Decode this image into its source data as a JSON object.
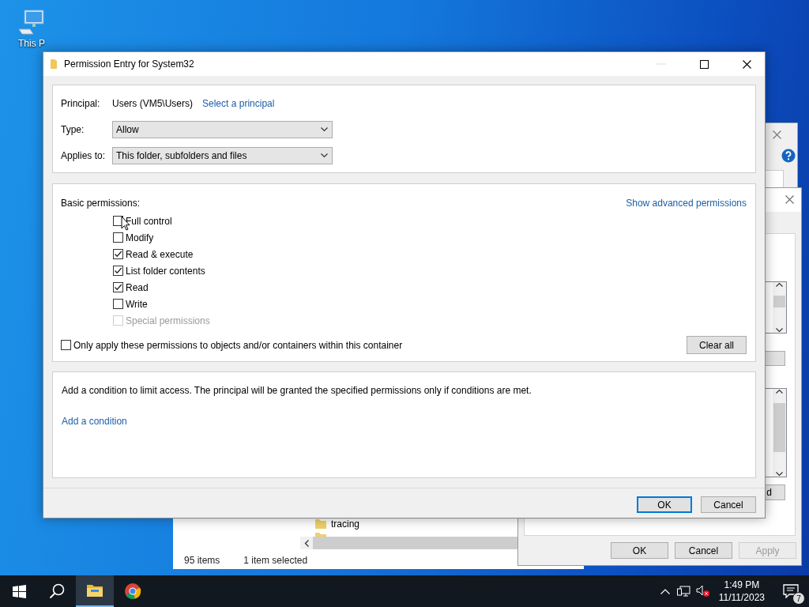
{
  "desktop": {
    "icons": [
      {
        "label": "This P"
      }
    ]
  },
  "explorer_window": {
    "items": [
      {
        "name": "tracing"
      }
    ],
    "status_bar": [
      "95 items",
      "1 item selected"
    ]
  },
  "security_dialog": {
    "partial_button": "d",
    "buttons": [
      {
        "label": "OK",
        "disabled": false
      },
      {
        "label": "Cancel",
        "disabled": false
      },
      {
        "label": "Apply",
        "disabled": true
      }
    ]
  },
  "dialog": {
    "title": "Permission Entry for System32",
    "principal": {
      "label": "Principal:",
      "value": "Users (VM5\\Users)",
      "link": "Select a principal"
    },
    "type": {
      "label": "Type:",
      "value": "Allow"
    },
    "applies_to": {
      "label": "Applies to:",
      "value": "This folder, subfolders and files"
    },
    "permissions": {
      "heading": "Basic permissions:",
      "link": "Show advanced permissions",
      "items": [
        {
          "label": "Full control",
          "checked": false,
          "disabled": false
        },
        {
          "label": "Modify",
          "checked": false,
          "disabled": false
        },
        {
          "label": "Read & execute",
          "checked": true,
          "disabled": false
        },
        {
          "label": "List folder contents",
          "checked": true,
          "disabled": false
        },
        {
          "label": "Read",
          "checked": true,
          "disabled": false
        },
        {
          "label": "Write",
          "checked": false,
          "disabled": false
        },
        {
          "label": "Special permissions",
          "checked": false,
          "disabled": true
        }
      ],
      "only_apply": {
        "label": "Only apply these permissions to objects and/or containers within this container",
        "checked": false
      },
      "clear_button": "Clear all"
    },
    "condition": {
      "text": "Add a condition to limit access. The principal will be granted the specified permissions only if conditions are met.",
      "link": "Add a condition"
    },
    "buttons": [
      {
        "label": "OK",
        "default": true
      },
      {
        "label": "Cancel",
        "default": false
      }
    ]
  },
  "taskbar": {
    "apps": [
      {
        "kind": "explorer",
        "active": true
      },
      {
        "kind": "browser",
        "active": false
      }
    ],
    "time": "1:49 PM",
    "date": "11/11/2023",
    "notifications": "7"
  }
}
